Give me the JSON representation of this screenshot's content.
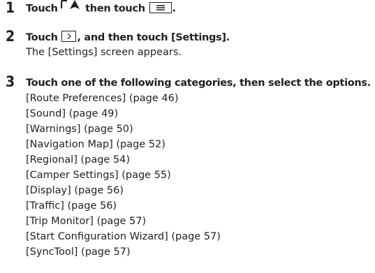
{
  "steps": [
    {
      "number": "1",
      "text_a": "Touch ",
      "icon_1": "map-screen-icon",
      "text_b": " then touch ",
      "icon_2": "menu-icon",
      "text_c": "."
    },
    {
      "number": "2",
      "text_a": "Touch ",
      "icon_1": "next-arrow-icon",
      "text_b": ", and then touch [Settings].",
      "result": "The [Settings] screen appears."
    },
    {
      "number": "3",
      "instruction": "Touch one of the following categories, then select the options.",
      "categories": [
        "[Route Preferences] (page 46)",
        "[Sound] (page 49)",
        "[Warnings] (page 50)",
        "[Navigation Map] (page 52)",
        "[Regional] (page 54)",
        "[Camper Settings] (page 55)",
        "[Display] (page 56)",
        "[Traffic] (page 56)",
        "[Trip Monitor] (page 57)",
        "[Start Configuration Wizard] (page 57)",
        "[SyncTool] (page 57)"
      ]
    }
  ]
}
